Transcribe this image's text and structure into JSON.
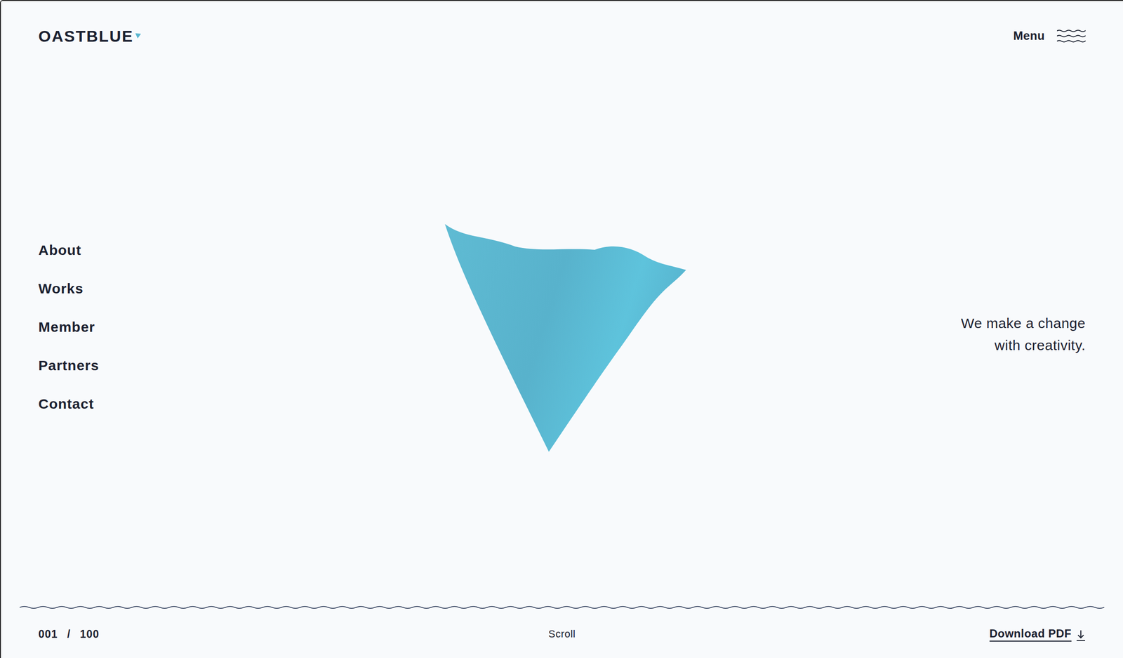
{
  "header": {
    "logo": "OASTBLUE",
    "menu_label": "Menu"
  },
  "nav": {
    "items": [
      "About",
      "Works",
      "Member",
      "Partners",
      "Contact"
    ]
  },
  "tagline": [
    "We make a change",
    "with creativity."
  ],
  "footer": {
    "page_current": "001",
    "separator": "/",
    "page_total": "100",
    "scroll_label": "Scroll",
    "download_label": "Download PDF"
  }
}
